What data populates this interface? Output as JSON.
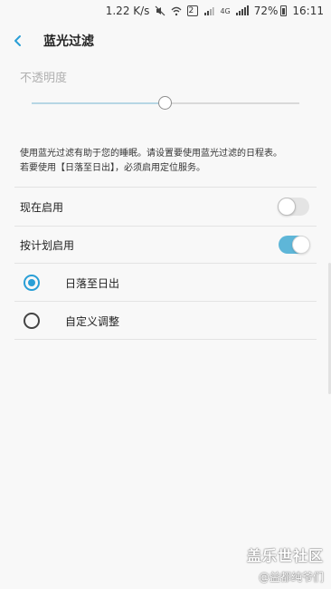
{
  "status_bar": {
    "speed": "1.22 K/s",
    "battery": "72%",
    "time": "16:11",
    "icons": [
      "mute-icon",
      "wifi-icon",
      "notification-2-icon",
      "signal-icon",
      "4g-icon",
      "battery-icon"
    ],
    "net_label": "4G",
    "notif_num": "2"
  },
  "header": {
    "title": "蓝光过滤",
    "back_icon": "back-chevron-icon"
  },
  "opacity": {
    "label": "不透明度",
    "value": 0.5
  },
  "description": {
    "line1": "使用蓝光过滤有助于您的睡眠。请设置要使用蓝光过滤的日程表。",
    "line2": "若要使用【日落至日出】，必须启用定位服务。"
  },
  "settings": {
    "turn_on_now": {
      "label": "现在启用",
      "enabled": false
    },
    "scheduled": {
      "label": "按计划启用",
      "enabled": true
    }
  },
  "schedule_options": [
    {
      "label": "日落至日出",
      "selected": true
    },
    {
      "label": "自定义调整",
      "selected": false
    }
  ],
  "colors": {
    "accent": "#2a9fd6",
    "switch_on": "#5eb6d8",
    "background": "#f8f8f8"
  },
  "watermark": {
    "line1": "盖乐世社区",
    "line2": "@益都纯爷们"
  }
}
